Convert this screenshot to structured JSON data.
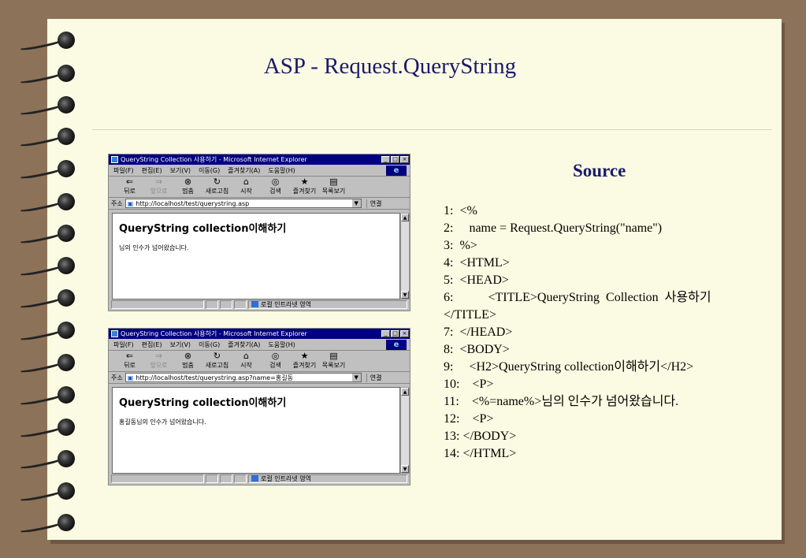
{
  "slide": {
    "title": "ASP - Request.QueryString",
    "source_title": "Source"
  },
  "browser": {
    "window_title": "QueryString Collection 사용하기 - Microsoft Internet Explorer",
    "menu": [
      "파일(F)",
      "편집(E)",
      "보기(V)",
      "이동(G)",
      "즐겨찾기(A)",
      "도움말(H)"
    ],
    "toolbar": [
      "뒤로",
      "앞으로",
      "멈춤",
      "새로고침",
      "시작",
      "검색",
      "즐겨찾기",
      "목록보기"
    ],
    "address_label": "주소",
    "go_label": "연결",
    "status_zone": "로컬 인트라넷 영역",
    "logo_glyph": "e",
    "colors": {
      "titlebar": "#000080",
      "chrome": "#c0c0c0"
    }
  },
  "screens": [
    {
      "url": "http://localhost/test/querystring.asp",
      "heading": "QueryString collection이해하기",
      "body": "님의 인수가 넘어왔습니다."
    },
    {
      "url": "http://localhost/test/querystring.asp?name=홍길동",
      "heading": "QueryString collection이해하기",
      "body": "홍길동님의 인수가 넘어왔습니다."
    }
  ],
  "code_lines": [
    "1:  <%",
    "2:     name = Request.QueryString(\"name\")",
    "3:  %>",
    "4:  <HTML>",
    "5:  <HEAD>",
    "6:           <TITLE>QueryString  Collection  사용하기",
    "</TITLE>",
    "7:  </HEAD>",
    "8:  <BODY>",
    "9:     <H2>QueryString collection이해하기</H2>",
    "10:    <P>",
    "11:    <%=name%>님의 인수가 넘어왔습니다.",
    "12:    <P>",
    "13: </BODY>",
    "14: </HTML>"
  ]
}
